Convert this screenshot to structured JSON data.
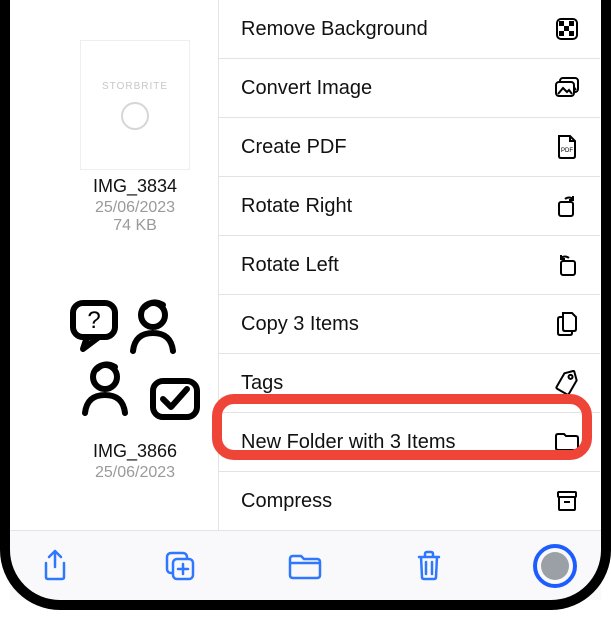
{
  "thumbnails": [
    {
      "watermark": "STORBRITE",
      "name": "IMG_3834",
      "date": "25/06/2023",
      "size": "74 KB"
    },
    {
      "name": "IMG_3866",
      "date": "25/06/2023",
      "size": ""
    }
  ],
  "menu": [
    {
      "label": "Remove Background",
      "icon": "checker"
    },
    {
      "label": "Convert Image",
      "icon": "images"
    },
    {
      "label": "Create PDF",
      "icon": "pdf-file"
    },
    {
      "label": "Rotate Right",
      "icon": "rotate-right"
    },
    {
      "label": "Rotate Left",
      "icon": "rotate-left"
    },
    {
      "label": "Copy 3 Items",
      "icon": "copy"
    },
    {
      "label": "Tags",
      "icon": "tag"
    },
    {
      "label": "New Folder with 3 Items",
      "icon": "folder-plus",
      "highlighted": true
    },
    {
      "label": "Compress",
      "icon": "archive"
    }
  ],
  "toolbar": {
    "share": "Share",
    "duplicate": "Duplicate",
    "folder": "Folder",
    "trash": "Delete",
    "more": "More"
  }
}
